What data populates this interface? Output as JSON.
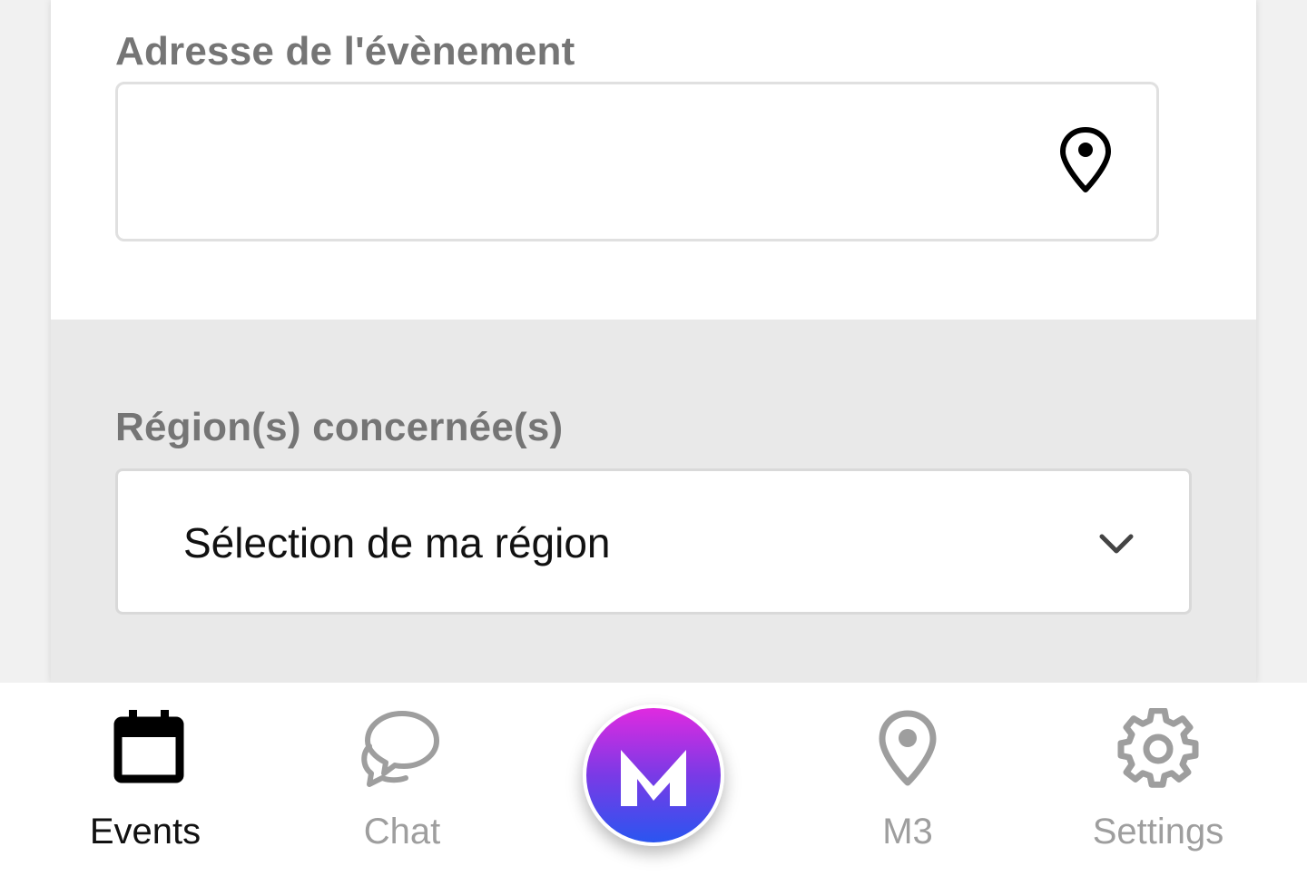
{
  "form": {
    "address": {
      "label": "Adresse de l'évènement",
      "value": "",
      "icon": "map-pin-icon"
    },
    "region": {
      "label": "Région(s) concernée(s)",
      "selected": "Sélection de ma région",
      "icon": "chevron-down-icon"
    }
  },
  "nav": {
    "items": [
      {
        "label": "Events",
        "icon": "calendar-icon",
        "active": true
      },
      {
        "label": "Chat",
        "icon": "chat-bubbles-icon",
        "active": false
      },
      {
        "label": "M3",
        "icon": "map-pin-icon",
        "active": false
      },
      {
        "label": "Settings",
        "icon": "gear-icon",
        "active": false
      }
    ],
    "center": {
      "icon": "app-logo-icon"
    }
  },
  "colors": {
    "label": "#757575",
    "active_nav": "#111111",
    "inactive_nav": "#9e9e9e",
    "gradient_top": "#e02ae0",
    "gradient_bottom": "#2a55f0"
  }
}
